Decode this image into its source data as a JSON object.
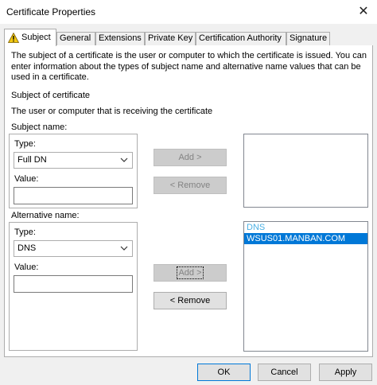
{
  "window": {
    "title": "Certificate Properties",
    "close_glyph": "✕"
  },
  "tabs": [
    {
      "label": "Subject",
      "active": true
    },
    {
      "label": "General"
    },
    {
      "label": "Extensions"
    },
    {
      "label": "Private Key"
    },
    {
      "label": "Certification Authority"
    },
    {
      "label": "Signature"
    }
  ],
  "description": "The subject of a certificate is the user or computer to which the certificate is issued. You can enter information about the types of subject name and alternative name values that can be used in a certificate.",
  "subject_of_certificate": {
    "heading": "Subject of certificate",
    "text": "The user or computer that is receiving the certificate"
  },
  "subject_name": {
    "label": "Subject name:",
    "type_label": "Type:",
    "type_value": "Full DN",
    "value_label": "Value:",
    "value_text": "",
    "add_button": "Add >",
    "remove_button": "< Remove"
  },
  "alternative_name": {
    "label": "Alternative name:",
    "type_label": "Type:",
    "type_value": "DNS",
    "value_label": "Value:",
    "value_text": "",
    "add_button": "Add >",
    "remove_button": "< Remove",
    "list_header": "DNS",
    "list_items": [
      "WSUS01.MANBAN.COM"
    ]
  },
  "footer": {
    "ok": "OK",
    "cancel": "Cancel",
    "apply": "Apply"
  },
  "colors": {
    "accent": "#0078d7",
    "warning": "#f2c811"
  }
}
